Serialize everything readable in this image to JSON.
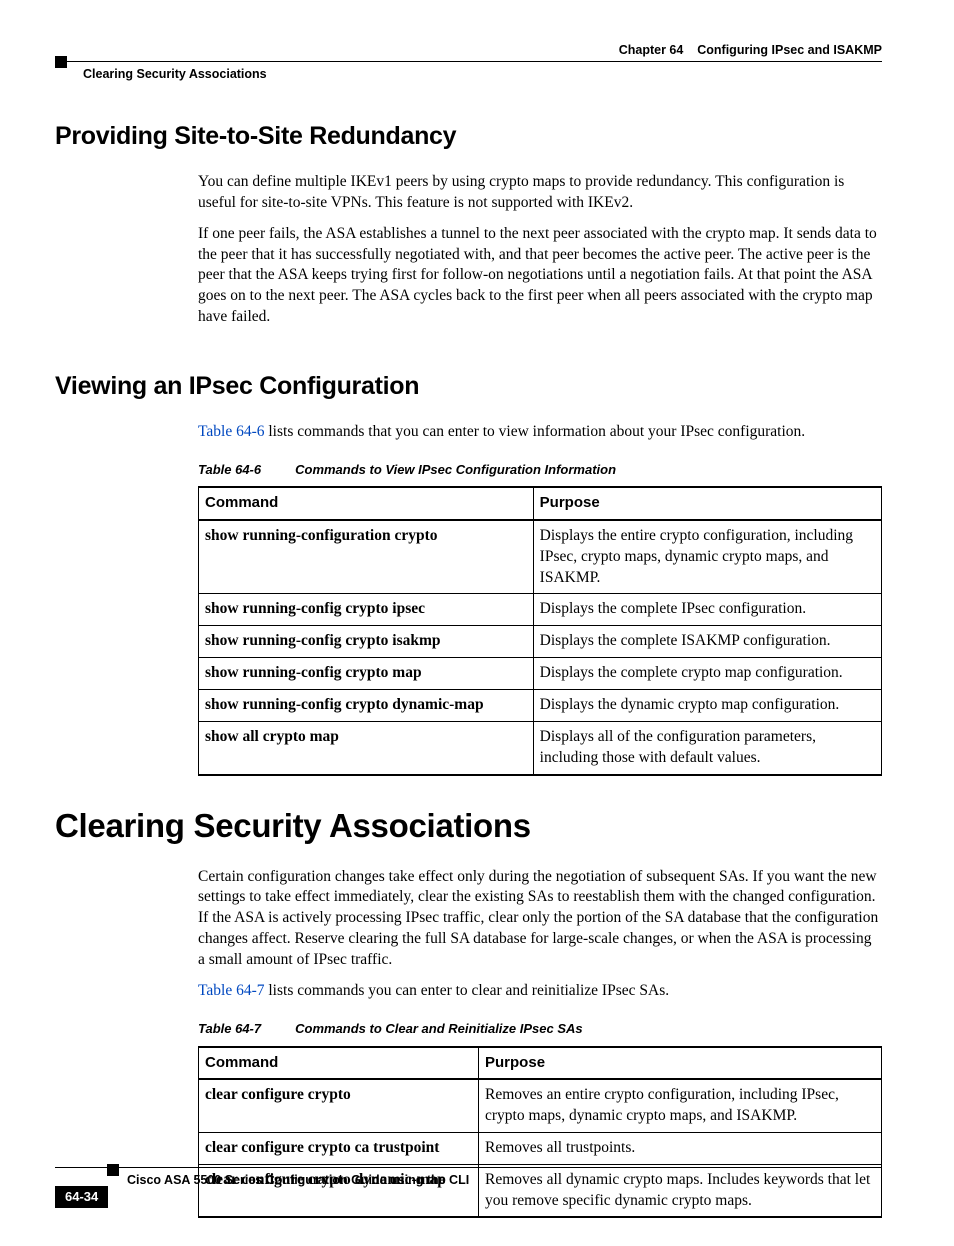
{
  "header": {
    "chapter_label": "Chapter 64",
    "chapter_title": "Configuring IPsec and ISAKMP",
    "breadcrumb": "Clearing Security Associations"
  },
  "section1": {
    "heading": "Providing Site-to-Site Redundancy",
    "p1": "You can define multiple IKEv1 peers by using crypto maps to provide redundancy. This configuration is useful for site-to-site VPNs. This feature is not supported with IKEv2.",
    "p2": "If one peer fails, the ASA establishes a tunnel to the next peer associated with the crypto map. It sends data to the peer that it has successfully negotiated with, and that peer becomes the active peer. The active peer is the peer that the ASA keeps trying first for follow-on negotiations until a negotiation fails. At that point the ASA goes on to the next peer. The ASA cycles back to the first peer when all peers associated with the crypto map have failed."
  },
  "section2": {
    "heading": "Viewing an IPsec Configuration",
    "intro_link": "Table 64-6",
    "intro_rest": " lists commands that you can enter to view information about your IPsec configuration.",
    "table_num": "Table 64-6",
    "table_title": "Commands to View IPsec Configuration Information",
    "col1": "Command",
    "col2": "Purpose",
    "rows": [
      {
        "cmd": "show running-configuration crypto",
        "purpose": "Displays the entire crypto configuration, including IPsec, crypto maps, dynamic crypto maps, and ISAKMP."
      },
      {
        "cmd": "show running-config crypto ipsec",
        "purpose": "Displays the complete IPsec configuration."
      },
      {
        "cmd": "show running-config crypto isakmp",
        "purpose": "Displays the complete ISAKMP configuration."
      },
      {
        "cmd": "show running-config crypto map",
        "purpose": "Displays the complete crypto map configuration."
      },
      {
        "cmd": "show running-config crypto dynamic-map",
        "purpose": "Displays the dynamic crypto map configuration."
      },
      {
        "cmd": "show all crypto map",
        "purpose": "Displays all of the configuration parameters, including those with default values."
      }
    ]
  },
  "section3": {
    "heading": "Clearing Security Associations",
    "p1": "Certain configuration changes take effect only during the negotiation of subsequent SAs. If you want the new settings to take effect immediately, clear the existing SAs to reestablish them with the changed configuration. If the ASA is actively processing IPsec traffic, clear only the portion of the SA database that the configuration changes affect. Reserve clearing the full SA database for large-scale changes, or when the ASA is processing a small amount of IPsec traffic.",
    "intro_link": "Table 64-7",
    "intro_rest": " lists commands you can enter to clear and reinitialize IPsec SAs.",
    "table_num": "Table 64-7",
    "table_title": "Commands to Clear and Reinitialize IPsec SAs",
    "col1": "Command",
    "col2": "Purpose",
    "rows": [
      {
        "cmd": "clear configure crypto",
        "purpose": "Removes an entire crypto configuration, including IPsec, crypto maps, dynamic crypto maps, and ISAKMP."
      },
      {
        "cmd": "clear configure crypto ca trustpoint",
        "purpose": "Removes all trustpoints."
      },
      {
        "cmd": "clear configure crypto dynamic-map",
        "purpose": "Removes all dynamic crypto maps. Includes keywords that let you remove specific dynamic crypto maps."
      }
    ]
  },
  "footer": {
    "doc_title": "Cisco ASA 5500 Series Configuration Guide using the CLI",
    "page_num": "64-34"
  }
}
